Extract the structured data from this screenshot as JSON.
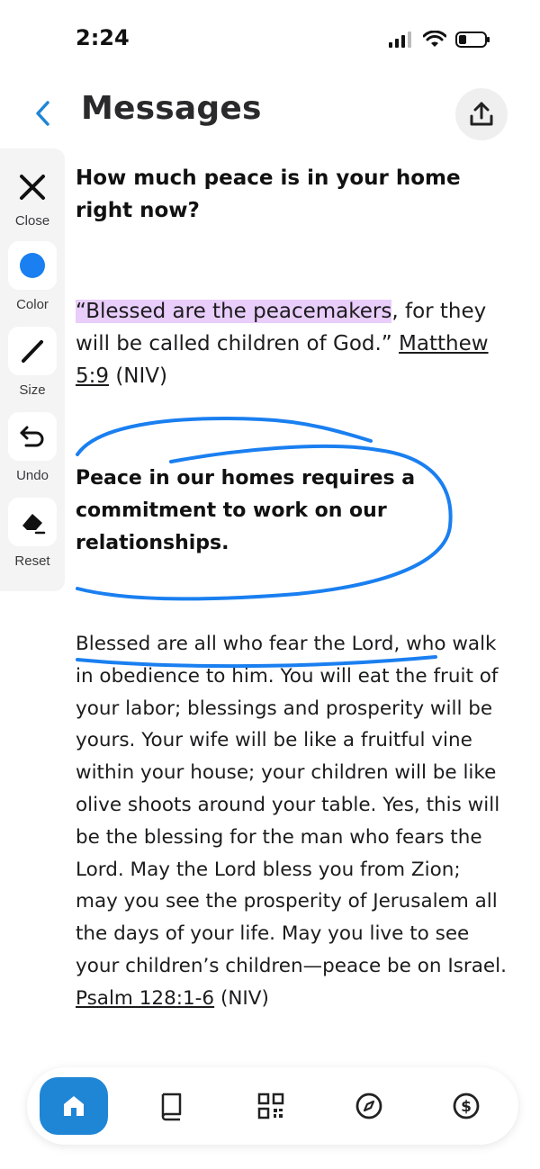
{
  "status_bar": {
    "time": "2:24"
  },
  "header": {
    "title": "Messages"
  },
  "toolbar": {
    "close_label": "Close",
    "color_label": "Color",
    "size_label": "Size",
    "undo_label": "Undo",
    "reset_label": "Reset",
    "selected_color": "#1a7ff0"
  },
  "content": {
    "question": "How much peace is in your home right now?",
    "verse1_highlight": "“Blessed are the peacemakers",
    "verse1_rest": ", for they will be called children of God.” ",
    "verse1_ref": "Matthew 5:9",
    "verse1_version": " (NIV)",
    "statement": "Peace in our homes requires a commitment to work on our relationships.",
    "psalm_text": "Blessed are all who fear the Lord, who walk in obedience to him. You will eat the fruit of your labor; blessings and prosperity will be yours. Your wife will be like a fruitful vine within your house; your children will be like olive shoots around your table. Yes, this will be the blessing for the man who fears the Lord. May the Lord bless you from Zion; may you see the prosperity of Jerusalem all the days of your life. May you live to see your children’s children—peace be on Israel. ",
    "psalm_ref": "Psalm 128:1-6",
    "psalm_version": " (NIV)"
  },
  "colors": {
    "accent": "#1f86d6",
    "highlight": "#e9cdfa",
    "ink": "#1a7ff0"
  },
  "bottom_nav": {
    "items": [
      "home-icon",
      "book-icon",
      "qr-code-icon",
      "compass-icon",
      "dollar-icon"
    ],
    "active": "home-icon"
  }
}
